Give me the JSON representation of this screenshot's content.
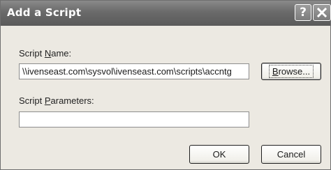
{
  "window": {
    "title": "Add a Script",
    "help_button": "?"
  },
  "form": {
    "name_label_before": "Script ",
    "name_label_key": "N",
    "name_label_after": "ame:",
    "name_value": "\\\\ivenseast.com\\sysvol\\ivenseast.com\\scripts\\accntg",
    "params_label_before": "Script ",
    "params_label_key": "P",
    "params_label_after": "arameters:",
    "params_value": ""
  },
  "buttons": {
    "browse_key": "B",
    "browse_rest": "rowse...",
    "ok": "OK",
    "cancel": "Cancel"
  },
  "icons": {
    "close": "close-x-icon",
    "help": "question-mark-icon"
  }
}
